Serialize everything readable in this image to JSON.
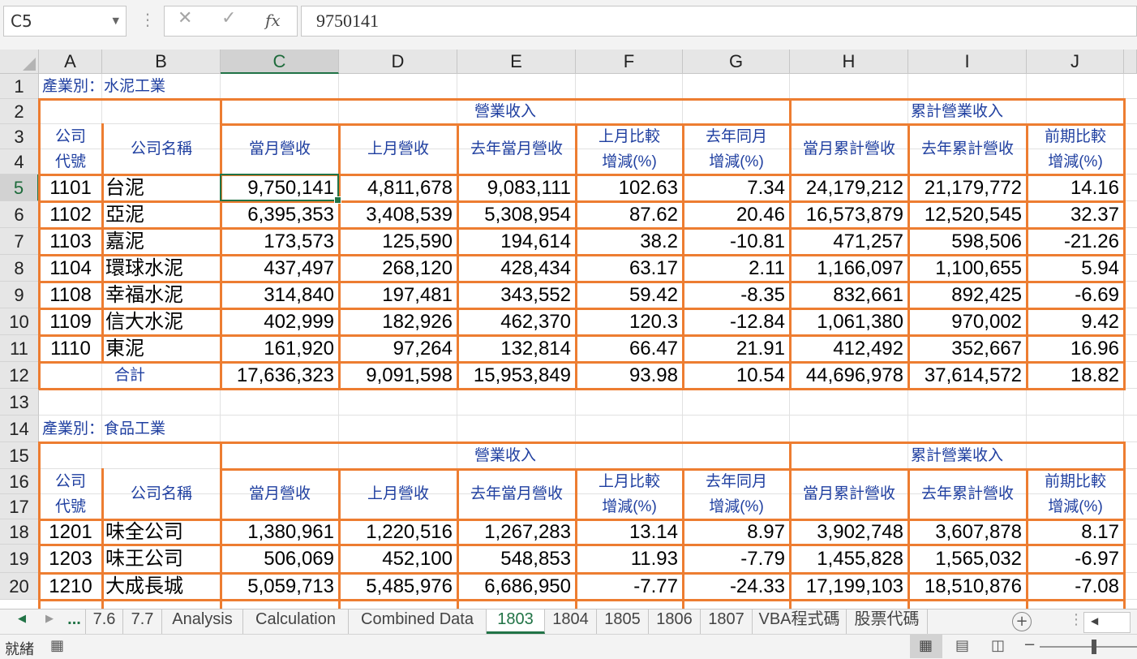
{
  "formula_bar": {
    "name_box": "C5",
    "fx_label": "fx",
    "formula": "9750141"
  },
  "columns": [
    "A",
    "B",
    "C",
    "D",
    "E",
    "F",
    "G",
    "H",
    "I",
    "J"
  ],
  "rows": [
    "1",
    "2",
    "3",
    "4",
    "5",
    "6",
    "7",
    "8",
    "9",
    "10",
    "11",
    "12",
    "13",
    "14",
    "15",
    "16",
    "17",
    "18",
    "19",
    "20"
  ],
  "block1": {
    "title": "產業別：水泥工業",
    "group_revenue": "營業收入",
    "group_cumulative": "累計營業收入",
    "h_code": [
      "公司",
      "代號"
    ],
    "h_name": "公司名稱",
    "h_cur": "當月營收",
    "h_prev": "上月營收",
    "h_lastyear": "去年當月營收",
    "h_mom": [
      "上月比較",
      "增減(%)"
    ],
    "h_yoy": [
      "去年同月",
      "增減(%)"
    ],
    "h_cum": "當月累計營收",
    "h_cum_ly": "去年累計營收",
    "h_cum_chg": [
      "前期比較",
      "增減(%)"
    ],
    "rows": [
      [
        "1101",
        "台泥",
        "9,750,141",
        "4,811,678",
        "9,083,111",
        "102.63",
        "7.34",
        "24,179,212",
        "21,179,772",
        "14.16"
      ],
      [
        "1102",
        "亞泥",
        "6,395,353",
        "3,408,539",
        "5,308,954",
        "87.62",
        "20.46",
        "16,573,879",
        "12,520,545",
        "32.37"
      ],
      [
        "1103",
        "嘉泥",
        "173,573",
        "125,590",
        "194,614",
        "38.2",
        "-10.81",
        "471,257",
        "598,506",
        "-21.26"
      ],
      [
        "1104",
        "環球水泥",
        "437,497",
        "268,120",
        "428,434",
        "63.17",
        "2.11",
        "1,166,097",
        "1,100,655",
        "5.94"
      ],
      [
        "1108",
        "幸福水泥",
        "314,840",
        "197,481",
        "343,552",
        "59.42",
        "-8.35",
        "832,661",
        "892,425",
        "-6.69"
      ],
      [
        "1109",
        "信大水泥",
        "402,999",
        "182,926",
        "462,370",
        "120.3",
        "-12.84",
        "1,061,380",
        "970,002",
        "9.42"
      ],
      [
        "1110",
        "東泥",
        "161,920",
        "97,264",
        "132,814",
        "66.47",
        "21.91",
        "412,492",
        "352,667",
        "16.96"
      ]
    ],
    "total": {
      "label": "合計",
      "values": [
        "17,636,323",
        "9,091,598",
        "15,953,849",
        "93.98",
        "10.54",
        "44,696,978",
        "37,614,572",
        "18.82"
      ]
    }
  },
  "block2": {
    "title": "產業別：食品工業",
    "group_revenue": "營業收入",
    "group_cumulative": "累計營業收入",
    "h_code": [
      "公司",
      "代號"
    ],
    "h_name": "公司名稱",
    "h_cur": "當月營收",
    "h_prev": "上月營收",
    "h_lastyear": "去年當月營收",
    "h_mom": [
      "上月比較",
      "增減(%)"
    ],
    "h_yoy": [
      "去年同月",
      "增減(%)"
    ],
    "h_cum": "當月累計營收",
    "h_cum_ly": "去年累計營收",
    "h_cum_chg": [
      "前期比較",
      "增減(%)"
    ],
    "rows": [
      [
        "1201",
        "味全公司",
        "1,380,961",
        "1,220,516",
        "1,267,283",
        "13.14",
        "8.97",
        "3,902,748",
        "3,607,878",
        "8.17"
      ],
      [
        "1203",
        "味王公司",
        "506,069",
        "452,100",
        "548,853",
        "11.93",
        "-7.79",
        "1,455,828",
        "1,565,032",
        "-6.97"
      ],
      [
        "1210",
        "大成長城",
        "5,059,713",
        "5,485,976",
        "6,686,950",
        "-7.77",
        "-24.33",
        "17,199,103",
        "18,510,876",
        "-7.08"
      ]
    ]
  },
  "sheet_tabs": [
    "...",
    "7.6",
    "7.7",
    "Analysis",
    "Calculation",
    "Combined Data",
    "1803",
    "1804",
    "1805",
    "1806",
    "1807",
    "VBA程式碼",
    "股票代碼"
  ],
  "active_tab": "1803",
  "status": {
    "text": "就緒"
  },
  "colors": {
    "accent": "#217346",
    "border_orange": "#ed7d31",
    "header_blue": "#1f3fa0"
  }
}
